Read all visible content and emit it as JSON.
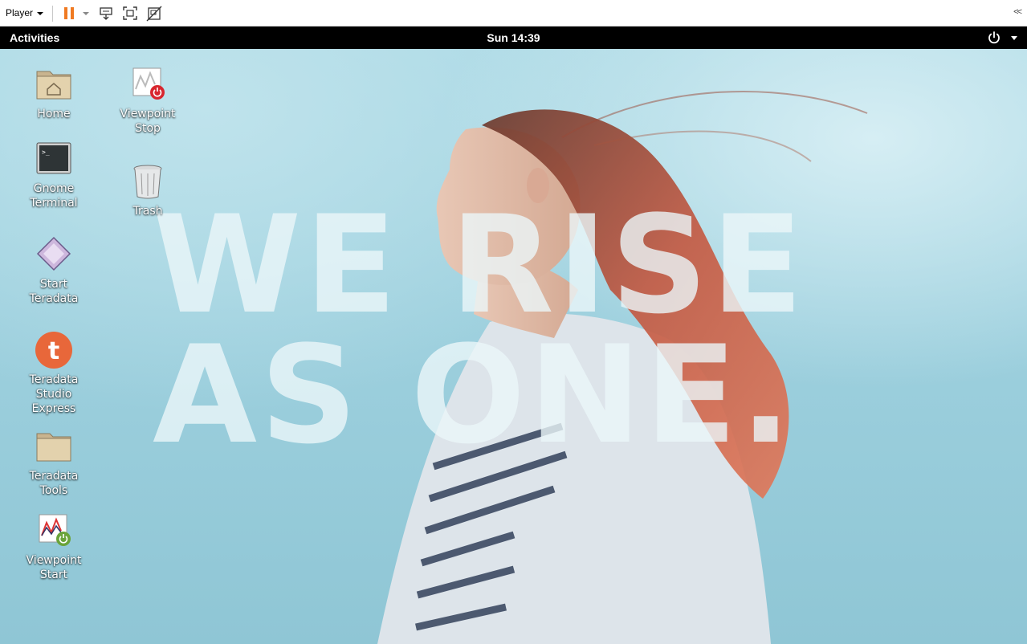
{
  "player": {
    "menu_label": "Player",
    "toolbar_icons": [
      "pause-icon",
      "dropdown-caret-icon",
      "send-ctrl-alt-del-icon",
      "fullscreen-icon",
      "unity-icon"
    ],
    "collapse_label": "<<"
  },
  "gnome": {
    "activities_label": "Activities",
    "clock": "Sun 14:39",
    "system_icons": [
      "power-icon",
      "chevron-down-icon"
    ]
  },
  "wallpaper": {
    "slogan_line1": "WE RISE",
    "slogan_line2": "AS ONE."
  },
  "desktop_icons": [
    {
      "label_line1": "Home",
      "label_line2": "",
      "icon": "folder-home-icon"
    },
    {
      "label_line1": "Gnome",
      "label_line2": "Terminal",
      "icon": "terminal-icon"
    },
    {
      "label_line1": "Start",
      "label_line2": "Teradata",
      "icon": "start-teradata-icon"
    },
    {
      "label_line1": "Teradata",
      "label_line2": "Studio",
      "label_line3": "Express",
      "icon": "teradata-studio-icon"
    },
    {
      "label_line1": "Teradata",
      "label_line2": "Tools",
      "icon": "folder-icon"
    },
    {
      "label_line1": "Viewpoint",
      "label_line2": "Start",
      "icon": "viewpoint-start-icon"
    },
    {
      "label_line1": "Viewpoint",
      "label_line2": "Stop",
      "icon": "viewpoint-stop-icon"
    },
    {
      "label_line1": "Trash",
      "label_line2": "",
      "icon": "trash-icon"
    }
  ],
  "colors": {
    "player_accent": "#f07a22",
    "gnome_bar": "#000000",
    "sky": "#9ccfdd",
    "teradata_orange": "#e8673a"
  }
}
